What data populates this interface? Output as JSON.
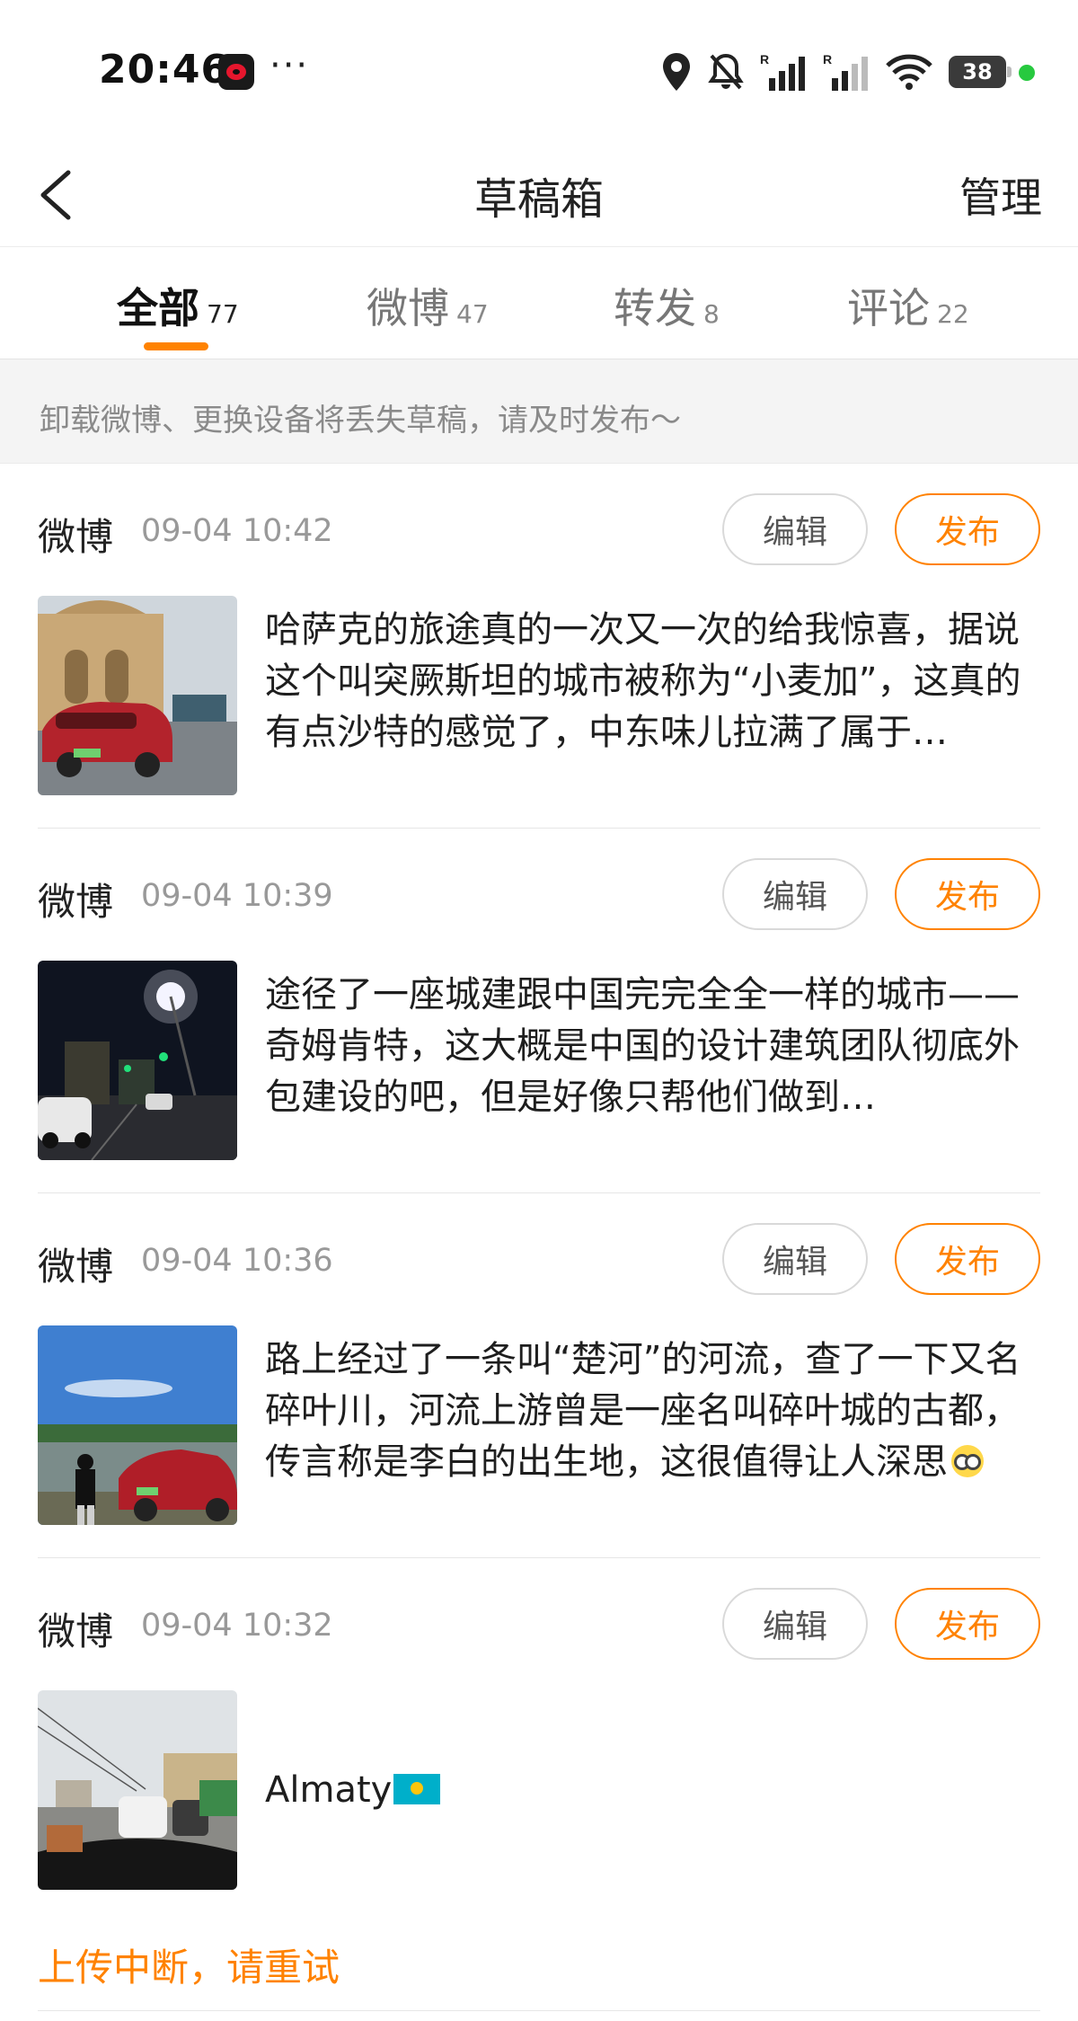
{
  "status_bar": {
    "time": "20:46",
    "app_icon": "weibo-logo",
    "more": "···",
    "icons": [
      "location-icon",
      "mute-bell-icon",
      "signal-r-icon",
      "signal-r-icon",
      "wifi-icon"
    ],
    "battery": "38"
  },
  "nav": {
    "back_icon": "chevron-left-icon",
    "title": "草稿箱",
    "manage": "管理"
  },
  "tabs": [
    {
      "label": "全部",
      "count": "77",
      "active": true
    },
    {
      "label": "微博",
      "count": "47",
      "active": false
    },
    {
      "label": "转发",
      "count": "8",
      "active": false
    },
    {
      "label": "评论",
      "count": "22",
      "active": false
    }
  ],
  "notice": "卸载微博、更换设备将丢失草稿，请及时发布～",
  "buttons": {
    "edit": "编辑",
    "publish": "发布"
  },
  "drafts": [
    {
      "type": "微博",
      "time": "09-04 10:42",
      "text": "哈萨克的旅途真的一次又一次的给我惊喜，据说这个叫突厥斯坦的城市被称为“小麦加”，这真的有点沙特的感觉了，中东味儿拉满了属于…",
      "thumb": "desert-building-red-car"
    },
    {
      "type": "微博",
      "time": "09-04 10:39",
      "text": "途径了一座城建跟中国完完全全一样的城市——奇姆肯特，这大概是中国的设计建筑团队彻底外包建设的吧，但是好像只帮他们做到…",
      "thumb": "night-street"
    },
    {
      "type": "微博",
      "time": "09-04 10:36",
      "text": "路上经过了一条叫“楚河”的河流，查了一下又名碎叶川，河流上游曾是一座名叫碎叶城的古都，传言称是李白的出生地，这很值得让人深思",
      "thumb": "river-red-car"
    },
    {
      "type": "微博",
      "time": "09-04 10:32",
      "text": "Almaty",
      "thumb": "road-traffic",
      "error": "上传中断，请重试"
    }
  ],
  "colors": {
    "accent": "#ff8200",
    "muted": "#999999"
  }
}
